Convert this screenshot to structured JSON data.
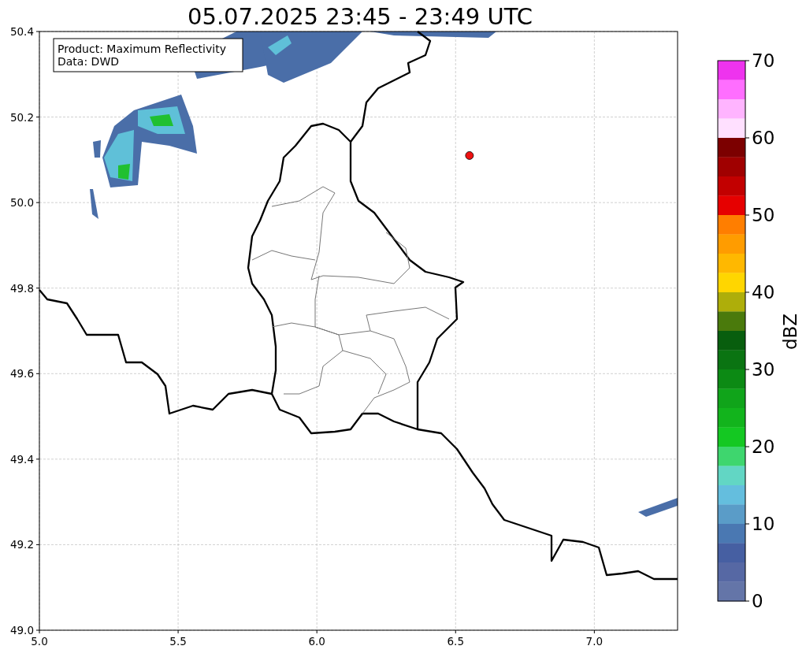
{
  "title": "05.07.2025 23:45 - 23:49 UTC",
  "map": {
    "info_box": [
      "Product: Maximum Reflectivity",
      "Data: DWD"
    ],
    "chart_data": {
      "type": "scatter",
      "xlim": [
        5.0,
        7.3
      ],
      "ylim": [
        49.0,
        50.4
      ],
      "xticks": [
        {
          "value": 5.0,
          "label": "5.0"
        },
        {
          "value": 5.5,
          "label": "5.5"
        },
        {
          "value": 6.0,
          "label": "6.0"
        },
        {
          "value": 6.5,
          "label": "6.5"
        },
        {
          "value": 7.0,
          "label": "7.0"
        }
      ],
      "yticks": [
        {
          "value": 49.0,
          "label": "49.0"
        },
        {
          "value": 49.2,
          "label": "49.2"
        },
        {
          "value": 49.4,
          "label": "49.4"
        },
        {
          "value": 49.6,
          "label": "49.6"
        },
        {
          "value": 49.8,
          "label": "49.8"
        },
        {
          "value": 50.0,
          "label": "50.0"
        },
        {
          "value": 50.2,
          "label": "50.2"
        },
        {
          "value": 50.4,
          "label": "50.4"
        }
      ],
      "x": [
        6.55
      ],
      "grid": true,
      "series": [
        {
          "color": "#ee1111",
          "values": [
            50.11
          ]
        }
      ]
    }
  },
  "colorbar": {
    "label": "dBZ",
    "ticks": [
      "70",
      "60",
      "50",
      "40",
      "30",
      "20",
      "10",
      "0"
    ],
    "bands": [
      {
        "color": "#ee33ee"
      },
      {
        "color": "#ff6eff"
      },
      {
        "color": "#ffb4ff"
      },
      {
        "color": "#ffe0ff"
      },
      {
        "color": "#7c0000"
      },
      {
        "color": "#a00000"
      },
      {
        "color": "#c20000"
      },
      {
        "color": "#e60000"
      },
      {
        "color": "#ff7e00"
      },
      {
        "color": "#ff9c00"
      },
      {
        "color": "#ffb800"
      },
      {
        "color": "#ffd600"
      },
      {
        "color": "#aeae0a"
      },
      {
        "color": "#4a7a0c"
      },
      {
        "color": "#085e0e"
      },
      {
        "color": "#0a7412"
      },
      {
        "color": "#0c8a14"
      },
      {
        "color": "#10a41a"
      },
      {
        "color": "#12b41c"
      },
      {
        "color": "#14c822"
      },
      {
        "color": "#3ed66e"
      },
      {
        "color": "#62d6c4"
      },
      {
        "color": "#64bede"
      },
      {
        "color": "#5a9cc8"
      },
      {
        "color": "#4a78b2"
      },
      {
        "color": "#465fa2"
      },
      {
        "color": "#5668a4"
      },
      {
        "color": "#6475a8"
      }
    ]
  }
}
